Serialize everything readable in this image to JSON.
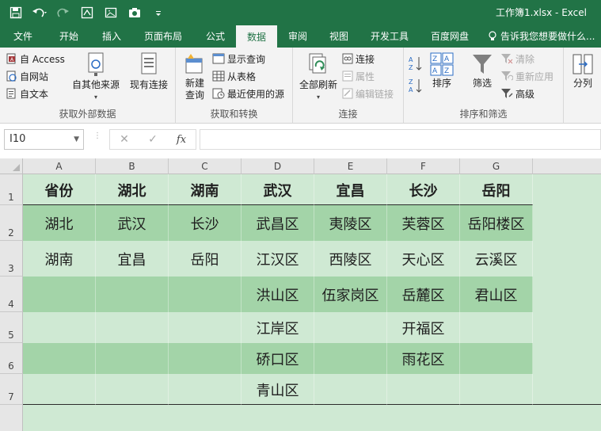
{
  "window": {
    "title": "工作簿1.xlsx - Excel"
  },
  "qat": {
    "icons": [
      "save-icon",
      "undo-icon",
      "redo-icon",
      "form-icon",
      "camera-icon",
      "customize-icon"
    ]
  },
  "tabs": [
    {
      "label": "文件"
    },
    {
      "label": "开始"
    },
    {
      "label": "插入"
    },
    {
      "label": "页面布局"
    },
    {
      "label": "公式"
    },
    {
      "label": "数据",
      "active": true
    },
    {
      "label": "审阅"
    },
    {
      "label": "视图"
    },
    {
      "label": "开发工具"
    },
    {
      "label": "百度网盘"
    }
  ],
  "tellme": "告诉我您想要做什么...",
  "ribbon": {
    "external": {
      "access": "自 Access",
      "web": "自网站",
      "text": "自文本",
      "other": "自其他来源",
      "existing": "现有连接",
      "label": "获取外部数据"
    },
    "transform": {
      "new_query": "新建",
      "new_query2": "查询",
      "show_queries": "显示查询",
      "from_table": "从表格",
      "recent": "最近使用的源",
      "label": "获取和转换"
    },
    "connections": {
      "refresh_all": "全部刷新",
      "connections": "连接",
      "properties": "属性",
      "edit_links": "编辑链接",
      "label": "连接"
    },
    "sort_filter": {
      "sort": "排序",
      "filter": "筛选",
      "clear": "清除",
      "reapply": "重新应用",
      "advanced": "高级",
      "label": "排序和筛选"
    },
    "tools": {
      "split": "分列"
    }
  },
  "formula_bar": {
    "name_box": "I10",
    "cancel": "✕",
    "enter": "✓",
    "fx": "fx",
    "content": ""
  },
  "columns": [
    "A",
    "B",
    "C",
    "D",
    "E",
    "F",
    "G"
  ],
  "rows": [
    "1",
    "2",
    "3",
    "4",
    "5",
    "6",
    "7"
  ],
  "cells": [
    [
      "省份",
      "湖北",
      "湖南",
      "武汉",
      "宜昌",
      "长沙",
      "岳阳"
    ],
    [
      "湖北",
      "武汉",
      "长沙",
      "武昌区",
      "夷陵区",
      "芙蓉区",
      "岳阳楼区"
    ],
    [
      "湖南",
      "宜昌",
      "岳阳",
      "江汉区",
      "西陵区",
      "天心区",
      "云溪区"
    ],
    [
      "",
      "",
      "",
      "洪山区",
      "伍家岗区",
      "岳麓区",
      "君山区"
    ],
    [
      "",
      "",
      "",
      "江岸区",
      "",
      "开福区",
      ""
    ],
    [
      "",
      "",
      "",
      "硚口区",
      "",
      "雨花区",
      ""
    ],
    [
      "",
      "",
      "",
      "青山区",
      "",
      "",
      ""
    ]
  ],
  "colors": {
    "brand": "#217346",
    "band_light": "#cfe9d3",
    "band_dark": "#a3d4a8"
  }
}
